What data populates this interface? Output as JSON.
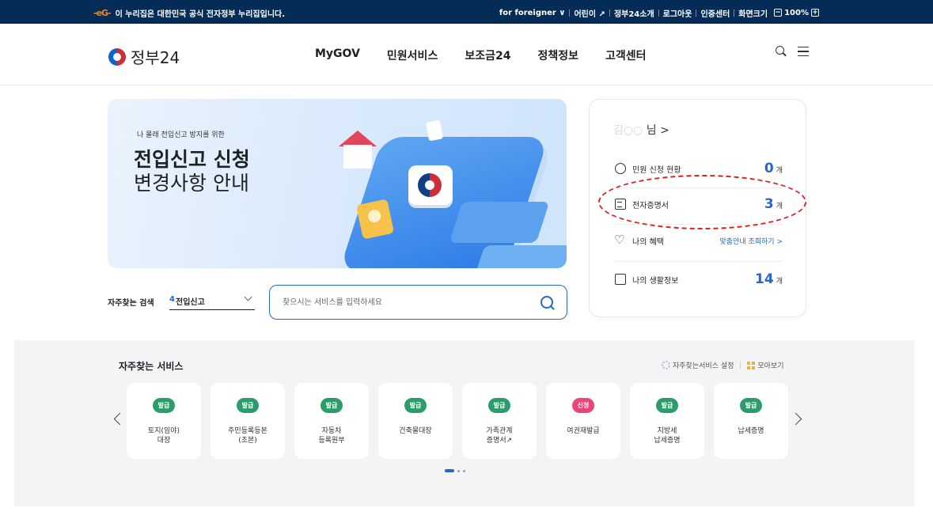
{
  "topbar": {
    "notice": "이 누리집은 대한민국 공식 전자정부 누리집입니다.",
    "links": [
      "for foreigner",
      "어린이",
      "정부24소개",
      "로그아웃",
      "인증센터",
      "화면크기"
    ],
    "foreigner_chevron": "∨",
    "kids_ext": "↗",
    "zoom_minus": "−",
    "zoom_value": "100%",
    "zoom_plus": "+"
  },
  "header": {
    "logo_text": "정부24",
    "nav": [
      "MyGOV",
      "민원서비스",
      "보조금24",
      "정책정보",
      "고객센터"
    ]
  },
  "banner": {
    "subtitle": "나 몰래 전입신고 방지를 위한",
    "title_line1": "전입신고 신청",
    "title_line2": "변경사항 안내"
  },
  "search": {
    "freq_label": "자주찾는 검색",
    "freq_rank": "4",
    "freq_value": "전입신고",
    "placeholder": "찾으시는 서비스를 입력하세요"
  },
  "user_panel": {
    "user_name": "김○○",
    "user_suffix": "님 >",
    "rows": [
      {
        "label": "민원 신청 현황",
        "count": "0",
        "unit": "개"
      },
      {
        "label": "전자증명서",
        "count": "3",
        "unit": "개"
      },
      {
        "label": "나의 혜택",
        "link": "맞춤안내 조회하기 >"
      },
      {
        "label": "나의 생활정보",
        "count": "14",
        "unit": "개"
      }
    ]
  },
  "services": {
    "title": "자주찾는 서비스",
    "setting_label": "자주찾는서비스 설정",
    "collect_label": "모아보기",
    "items": [
      {
        "badge": "발급",
        "name": "토지(임야)\n대장",
        "color": "green"
      },
      {
        "badge": "발급",
        "name": "주민등록등본\n(초본)",
        "color": "green"
      },
      {
        "badge": "발급",
        "name": "자동차\n등록원부",
        "color": "green"
      },
      {
        "badge": "발급",
        "name": "건축물대장",
        "color": "green"
      },
      {
        "badge": "발급",
        "name": "가족관계\n증명서↗",
        "color": "green"
      },
      {
        "badge": "신청",
        "name": "여권재발급",
        "color": "pink"
      },
      {
        "badge": "발급",
        "name": "지방세\n납세증명",
        "color": "green"
      },
      {
        "badge": "발급",
        "name": "납세증명",
        "color": "green"
      }
    ]
  },
  "colors": {
    "topbar": "#052b57",
    "accent": "#2966c9",
    "badge_green": "#2b9d6a",
    "badge_pink": "#e8467a",
    "annotation": "#e01f1f"
  }
}
